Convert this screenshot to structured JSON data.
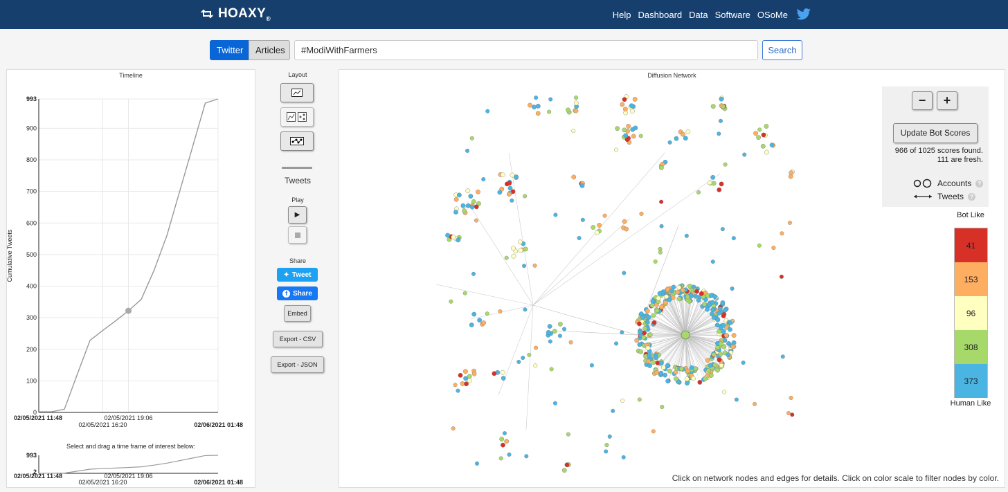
{
  "nav": {
    "brand": "HOAXY",
    "brand_mark": "®",
    "links": [
      "Help",
      "Dashboard",
      "Data",
      "Software",
      "OSoMe"
    ]
  },
  "search": {
    "tab_twitter": "Twitter",
    "tab_articles": "Articles",
    "query": "#ModiWithFarmers",
    "button": "Search"
  },
  "timeline": {
    "title": "Timeline",
    "y_label": "Cumulative Tweets",
    "select_hint": "Select and drag a time frame of interest below:",
    "x_labels": [
      "02/05/2021 11:48",
      "02/05/2021 16:20",
      "02/05/2021 19:06",
      "02/06/2021 01:48"
    ],
    "brush_y_max": "993",
    "brush_y_min": "2"
  },
  "controls": {
    "layout": "Layout",
    "tweets": "Tweets",
    "play": "Play",
    "share": "Share",
    "tweet_btn": "Tweet",
    "share_btn": "Share",
    "embed_btn": "Embed",
    "export_csv": "Export - CSV",
    "export_json": "Export - JSON"
  },
  "network": {
    "title": "Diffusion Network",
    "zoom_out": "−",
    "zoom_in": "+",
    "update_btn": "Update Bot Scores",
    "scores_found": "966 of 1025 scores found.",
    "fresh": "111 are fresh.",
    "legend_accounts": "Accounts",
    "legend_tweets": "Tweets",
    "scale_top": "Bot Like",
    "scale_bottom": "Human Like",
    "scale": [
      {
        "count": "41",
        "color": "#d73027"
      },
      {
        "count": "153",
        "color": "#fdae61"
      },
      {
        "count": "96",
        "color": "#ffffbf"
      },
      {
        "count": "308",
        "color": "#a6d96a"
      },
      {
        "count": "373",
        "color": "#4ab5e3"
      }
    ],
    "footer": "Click on network nodes and edges for details. Click on color scale to filter nodes by color."
  },
  "chart_data": {
    "type": "line",
    "title": "Timeline",
    "ylabel": "Cumulative Tweets",
    "xlabel": "",
    "ylim": [
      0,
      993
    ],
    "yticks": [
      0,
      100,
      200,
      300,
      400,
      500,
      600,
      700,
      800,
      900,
      993
    ],
    "x": [
      "02/05/2021 11:48",
      "02/05/2021 12:30",
      "02/05/2021 13:30",
      "02/05/2021 14:30",
      "02/05/2021 15:30",
      "02/05/2021 16:20",
      "02/05/2021 17:30",
      "02/05/2021 19:06",
      "02/05/2021 19:40",
      "02/05/2021 20:30",
      "02/05/2021 21:20",
      "02/05/2021 22:20",
      "02/05/2021 23:30",
      "02/06/2021 00:30",
      "02/06/2021 01:48"
    ],
    "series": [
      {
        "values": [
          2,
          2,
          10,
          120,
          228,
          260,
          290,
          322,
          358,
          450,
          560,
          700,
          840,
          980,
          993
        ]
      }
    ],
    "highlight_point": {
      "x": "02/05/2021 19:06",
      "y": 322
    }
  }
}
